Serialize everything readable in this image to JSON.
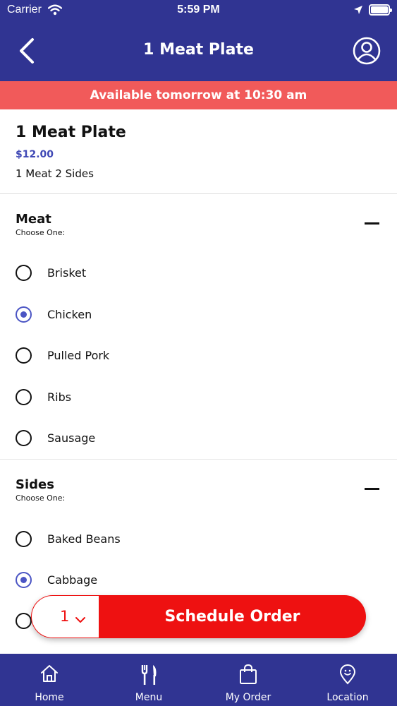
{
  "status_bar": {
    "carrier": "Carrier",
    "time": "5:59 PM"
  },
  "header": {
    "title": "1 Meat Plate",
    "back_icon": "chevron-left-icon",
    "profile_icon": "user-circle-icon"
  },
  "banner": {
    "text": "Available tomorrow at 10:30 am",
    "color": "#f15a5a"
  },
  "product": {
    "name": "1 Meat Plate",
    "price": "$12.00",
    "description": "1 Meat 2 Sides"
  },
  "meat": {
    "title": "Meat",
    "subtitle": "Choose One:",
    "options": [
      {
        "label": "Brisket",
        "selected": false
      },
      {
        "label": "Chicken",
        "selected": true
      },
      {
        "label": "Pulled Pork",
        "selected": false
      },
      {
        "label": "Ribs",
        "selected": false
      },
      {
        "label": "Sausage",
        "selected": false
      }
    ]
  },
  "sides": {
    "title": "Sides",
    "subtitle": "Choose One:",
    "options": [
      {
        "label": "Baked Beans",
        "selected": false
      },
      {
        "label": "Cabbage",
        "selected": true
      }
    ]
  },
  "action": {
    "quantity": "1",
    "button_label": "Schedule Order",
    "color": "#ee1111"
  },
  "tabs": [
    {
      "label": "Home",
      "icon": "home-icon"
    },
    {
      "label": "Menu",
      "icon": "fork-knife-icon"
    },
    {
      "label": "My Order",
      "icon": "shopping-bag-icon"
    },
    {
      "label": "Location",
      "icon": "location-pin-icon"
    }
  ],
  "colors": {
    "primary": "#303492",
    "accent": "#4b55c4"
  }
}
